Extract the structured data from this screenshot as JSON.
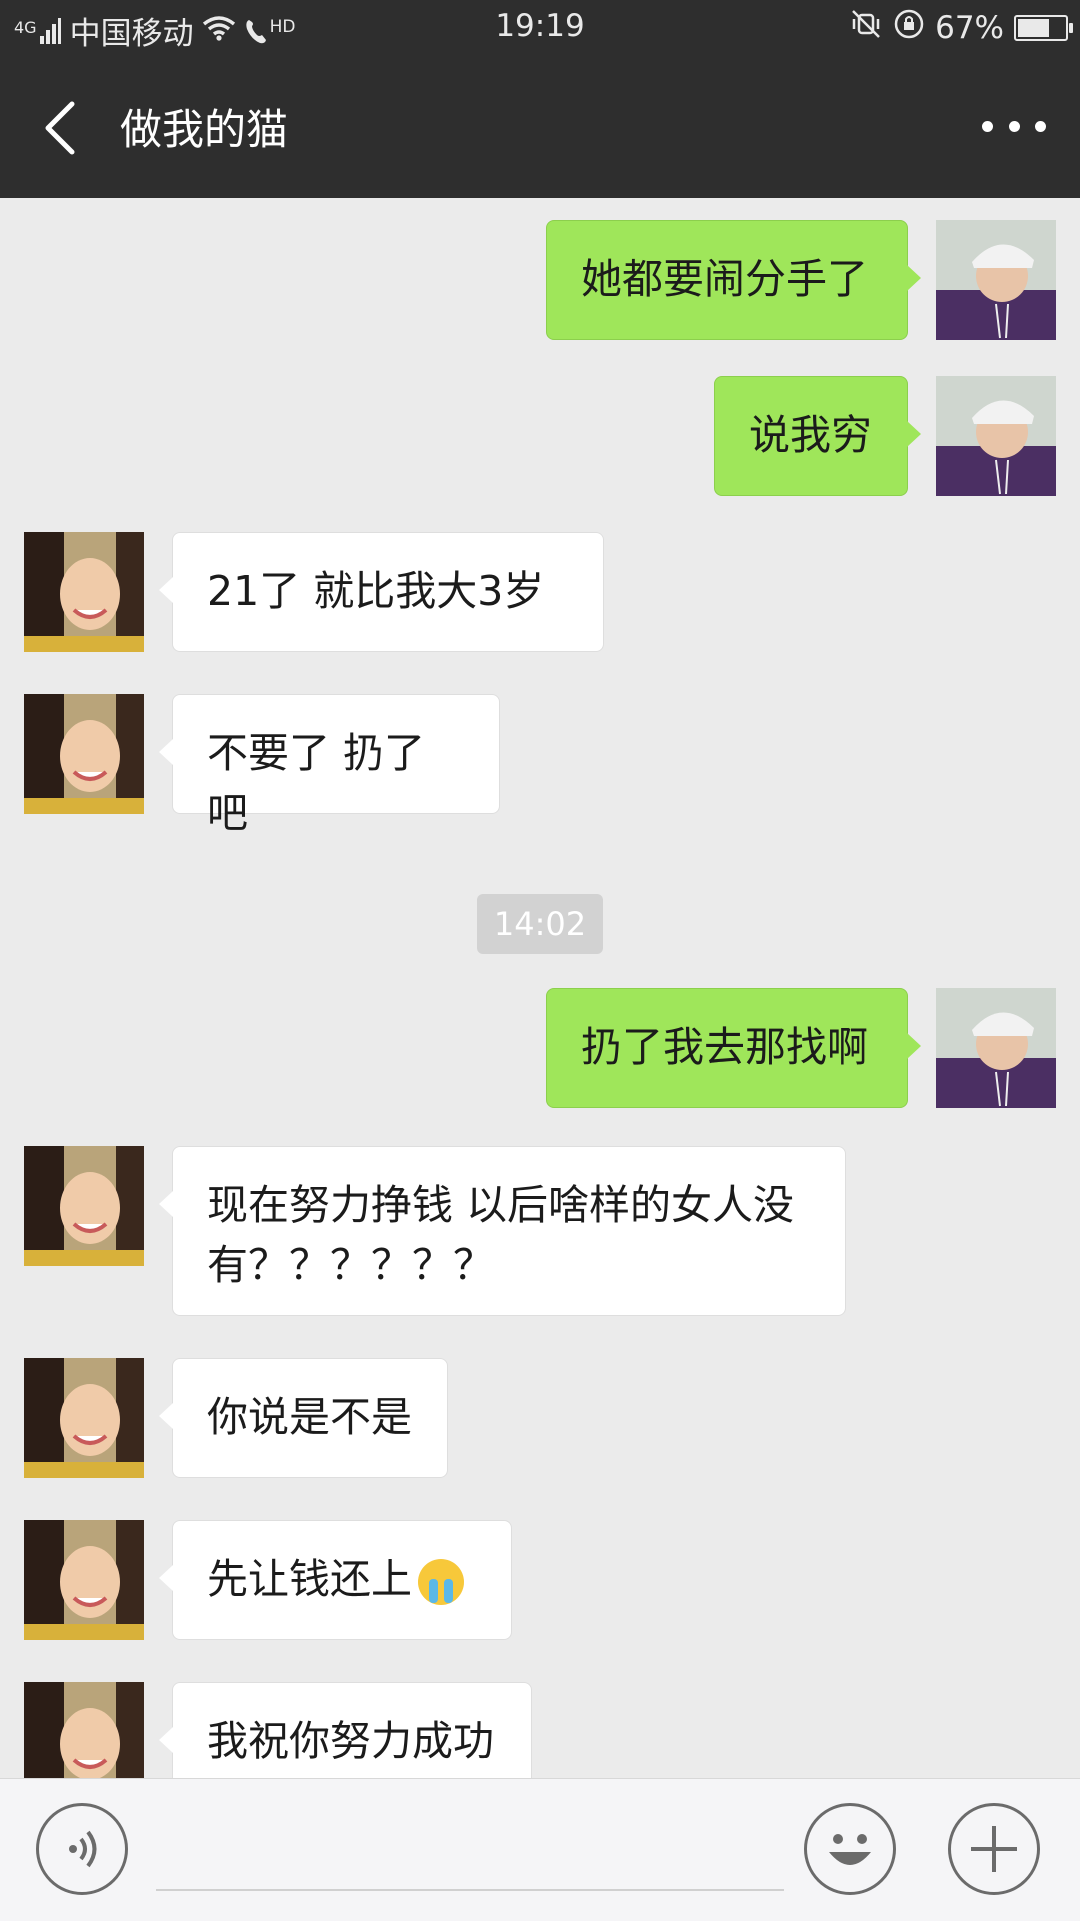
{
  "status_bar": {
    "network": "4G",
    "carrier": "中国移动",
    "hd": "HD",
    "time": "19:19",
    "battery": "67%",
    "battery_level": 0.67
  },
  "header": {
    "title": "做我的猫",
    "back_icon": "chevron-left-icon",
    "more_icon": "more-dots-icon"
  },
  "messages": [
    {
      "side": "right",
      "text": "她都要闹分手了"
    },
    {
      "side": "right",
      "text": "说我穷"
    },
    {
      "side": "left",
      "text": "21了  就比我大3岁"
    },
    {
      "side": "left",
      "text": "不要了 扔了吧"
    },
    {
      "side": "right",
      "text": "扔了我去那找啊"
    },
    {
      "side": "left",
      "text": "现在努力挣钱  以后啥样的女人没有？？？？？？"
    },
    {
      "side": "left",
      "text": "你说是不是"
    },
    {
      "side": "left",
      "text": "先让钱还上",
      "emoji": "crying-face-icon"
    },
    {
      "side": "left",
      "text": "我祝你努力成功"
    }
  ],
  "timestamp": "14:02",
  "input_bar": {
    "voice_icon": "voice-icon",
    "emoji_icon": "smiley-icon",
    "plus_icon": "plus-icon"
  },
  "colors": {
    "header_bg": "#2e2e2e",
    "chat_bg": "#ebebeb",
    "sent_bubble": "#9fe65a",
    "received_bubble": "#ffffff"
  }
}
